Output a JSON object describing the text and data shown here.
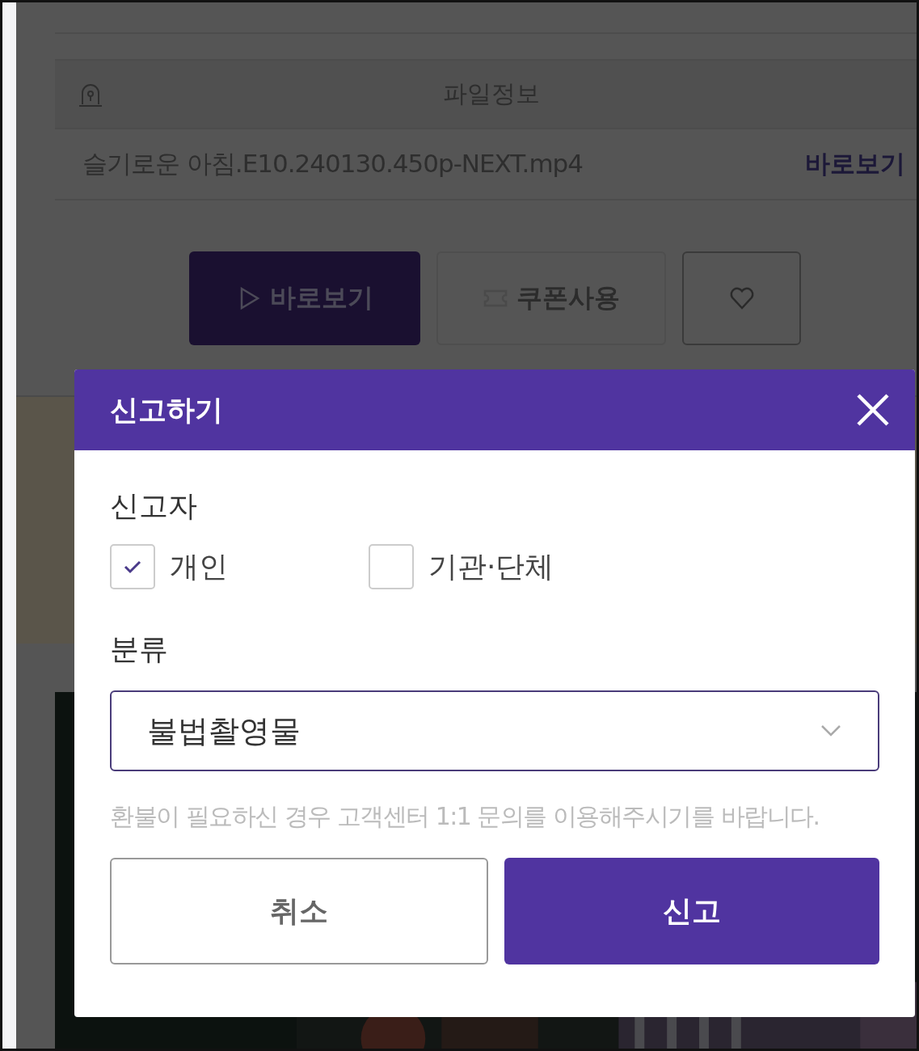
{
  "file_table": {
    "header": "파일정보",
    "files": [
      {
        "name": "슬기로운 아침.E10.240130.450p-NEXT.mp4",
        "action": "바로보기"
      }
    ]
  },
  "actions": [
    {
      "kind": "play",
      "label": "바로보기"
    },
    {
      "kind": "coupon",
      "label": "쿠폰사용"
    },
    {
      "kind": "favorite"
    }
  ],
  "dialog": {
    "title": "신고하기",
    "reporter": {
      "label": "신고자",
      "options": [
        {
          "label": "개인",
          "checked": true
        },
        {
          "label": "기관·단체",
          "checked": false
        }
      ]
    },
    "category": {
      "label": "분류",
      "value": "불법촬영물"
    },
    "notice": "환불이 필요하신 경우 고객센터 1:1 문의를 이용해주시기를 바랍니다.",
    "buttons": [
      {
        "kind": "cancel",
        "label": "취소"
      },
      {
        "kind": "submit",
        "label": "신고"
      }
    ]
  }
}
